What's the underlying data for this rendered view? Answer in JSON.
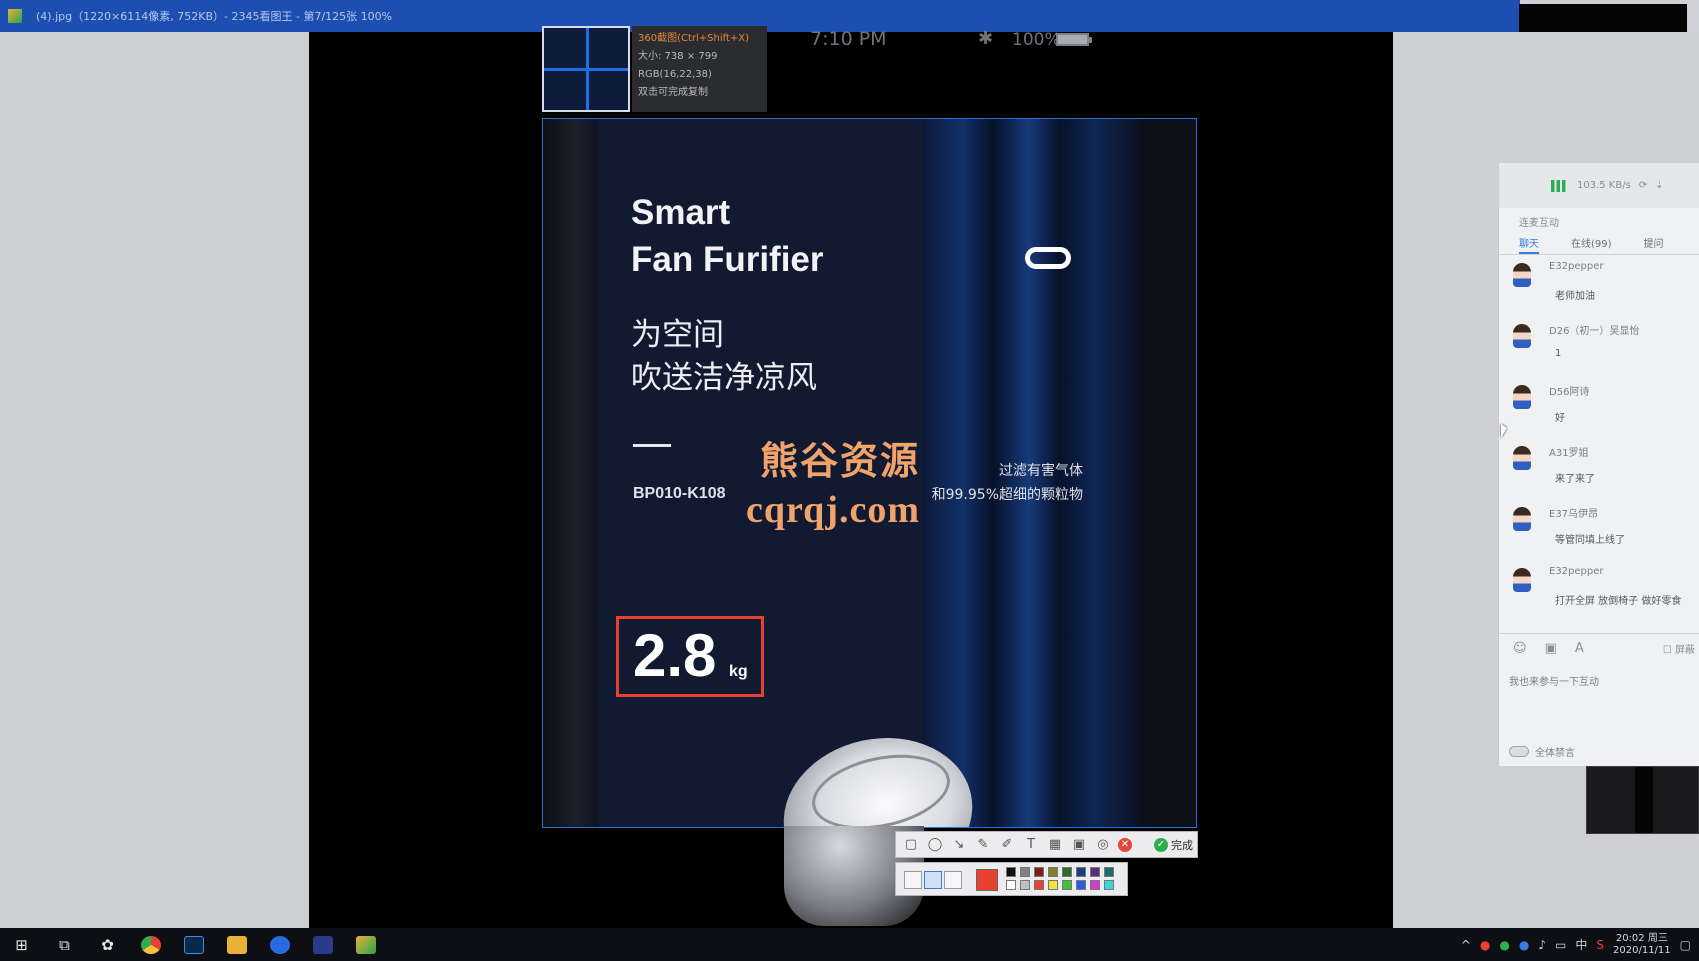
{
  "window": {
    "title": "(4).jpg（1220×6114像素, 752KB）- 2345看图王 - 第7/125张 100%"
  },
  "phone_status": {
    "time": "7:10 PM",
    "bluetooth_icon": "✱",
    "battery": "100%"
  },
  "capture_tool": {
    "hint": "360截图(Ctrl+Shift+X)",
    "size": "大小: 738 × 799",
    "rgb": "RGB(16,22,38)",
    "action": "双击可完成复制",
    "done_label": "完成",
    "selected_color": "#e8412f",
    "palette": [
      "#111111",
      "#808080",
      "#7f1d1d",
      "#8a7a2b",
      "#2b6b2b",
      "#1d3b7f",
      "#5a2b7f",
      "#1d6b6b",
      "#ffffff",
      "#c0c0c0",
      "#e8412f",
      "#f4e13a",
      "#3cc43c",
      "#2b5be8",
      "#d43bd4",
      "#3bd4d4"
    ]
  },
  "poster": {
    "title_line1": "Smart",
    "title_line2": "Fan Furifier",
    "cn_line1": "为空间",
    "cn_line2": "吹送洁净凉风",
    "model": "BP010-K108",
    "desc_line1": "过滤有害气体",
    "desc_line2": "和99.95%超细的颗粒物",
    "weight_value": "2.8",
    "weight_unit": "kg",
    "accent": "#e8412f"
  },
  "watermark": {
    "cn": "熊谷资源",
    "url": "cqrqj.com"
  },
  "chat": {
    "net_speed": "103.5 KB/s",
    "section": "连麦互动",
    "tabs": [
      "聊天",
      "在线(99)",
      "提问"
    ],
    "messages": [
      {
        "name": "E32pepper",
        "text": "老师加油"
      },
      {
        "name": "D26（初一）吴显怡",
        "text": "1"
      },
      {
        "name": "D56阿诗",
        "text": "好"
      },
      {
        "name": "A31罗姐",
        "text": "来了来了"
      },
      {
        "name": "E37乌伊昂",
        "text": "等管同填上线了"
      },
      {
        "name": "E32pepper",
        "text": "打开全屏 放倒椅子 做好零食"
      }
    ],
    "checkbox_label": "屏蔽",
    "input_hint": "我也来参与一下互动",
    "mute_label": "全体禁言"
  },
  "taskbar": {
    "clock_time": "20:02 周三",
    "clock_date": "2020/11/11",
    "ime": "中"
  }
}
